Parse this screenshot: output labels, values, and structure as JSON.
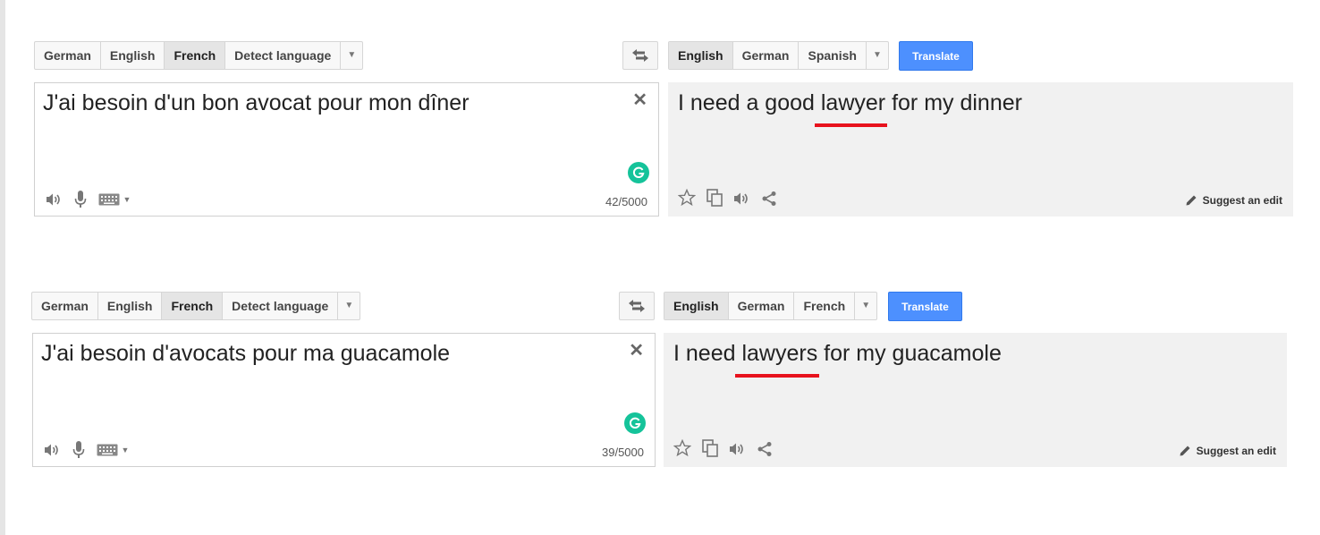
{
  "accent": "#4d90fe",
  "highlight_color": "#e8121d",
  "grammarly_color": "#15c39a",
  "panels": [
    {
      "source_languages": [
        "German",
        "English",
        "French",
        "Detect language"
      ],
      "source_selected": "French",
      "target_languages": [
        "English",
        "German",
        "Spanish"
      ],
      "target_selected": "English",
      "translate_label": "Translate",
      "source_text": "J'ai besoin d'un bon avocat pour mon dîner",
      "char_count": "42/5000",
      "output_before": "I need a good ",
      "output_highlight": "lawyer",
      "output_after": " for my dinner",
      "suggest_label": "Suggest an edit"
    },
    {
      "source_languages": [
        "German",
        "English",
        "French",
        "Detect language"
      ],
      "source_selected": "French",
      "target_languages": [
        "English",
        "German",
        "French"
      ],
      "target_selected": "English",
      "translate_label": "Translate",
      "source_text": "J'ai besoin d'avocats pour ma guacamole",
      "char_count": "39/5000",
      "output_before": "I need ",
      "output_highlight": "lawyers",
      "output_after": " for my guacamole",
      "suggest_label": "Suggest an edit"
    }
  ],
  "icons": {
    "clear": "close-icon",
    "swap": "swap-languages-icon",
    "speaker": "speaker-icon",
    "mic": "microphone-icon",
    "keyboard": "keyboard-icon",
    "star": "star-icon",
    "copy": "copy-icon",
    "share": "share-icon",
    "pencil": "pencil-icon",
    "grammarly": "grammarly-icon"
  }
}
